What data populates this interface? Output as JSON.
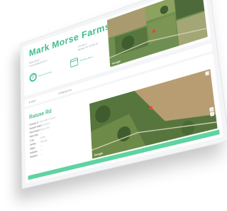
{
  "farm": {
    "name": "Mark Morse Farms",
    "owner_lines": [
      "Mark Morse",
      "mmorse@gmail.com"
    ],
    "address_lines": [
      "PO Box 0",
      "Benson NY 00780-00"
    ]
  },
  "stats": [
    {
      "value": "0",
      "label": "Samples Pending",
      "icon": "ring-icon"
    },
    {
      "label": "Sampling Date 1",
      "icon": "calendar-icon"
    }
  ],
  "tabs": {
    "year": "▾ 2020",
    "field": "▾ Raluse Rd"
  },
  "field": {
    "title": "Raluse Rd",
    "rows": [
      {
        "key": "Sample Id",
        "value": "2020-0547-00-00"
      },
      {
        "key": "Sample Date",
        "value": "06/19/2020"
      },
      {
        "key": "Field Name",
        "value": "Raluse Rd"
      },
      {
        "key": "Field Size",
        "value": "—"
      },
      {
        "key": "Crop",
        "value": "Grass"
      },
      {
        "key": "Variety",
        "value": "Timothy"
      },
      {
        "key": "Stage",
        "value": "—"
      },
      {
        "key": "Analysis",
        "value": "—"
      },
      {
        "key": "Weather",
        "value": "—"
      }
    ]
  },
  "map": {
    "label": "Google"
  },
  "colors": {
    "accent": "#3dbb8a",
    "bar": "#5fd3a0"
  }
}
